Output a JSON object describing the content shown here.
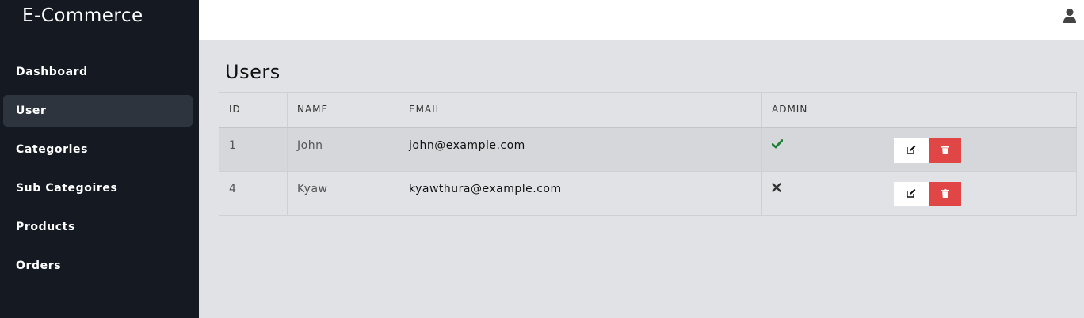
{
  "app": {
    "brand": "E-Commerce"
  },
  "sidebar": {
    "items": [
      {
        "label": "Dashboard",
        "active": false
      },
      {
        "label": "User",
        "active": true
      },
      {
        "label": "Categories",
        "active": false
      },
      {
        "label": "Sub Categoires",
        "active": false
      },
      {
        "label": "Products",
        "active": false
      },
      {
        "label": "Orders",
        "active": false
      }
    ]
  },
  "topbar": {
    "icon": "user-icon"
  },
  "main": {
    "title": "Users",
    "table": {
      "headers": [
        "ID",
        "NAME",
        "EMAIL",
        "ADMIN",
        ""
      ],
      "rows": [
        {
          "id": "1",
          "name": "John",
          "email": "john@example.com",
          "admin": true,
          "admin_icon": "check-icon"
        },
        {
          "id": "4",
          "name": "Kyaw",
          "email": "kyawthura@example.com",
          "admin": false,
          "admin_icon": "x-icon"
        }
      ]
    }
  },
  "colors": {
    "sidebar_bg": "#141922",
    "sidebar_active": "#2e343e",
    "page_bg": "#e1e2e6",
    "check": "#1e7e34",
    "delete": "#e04646"
  }
}
